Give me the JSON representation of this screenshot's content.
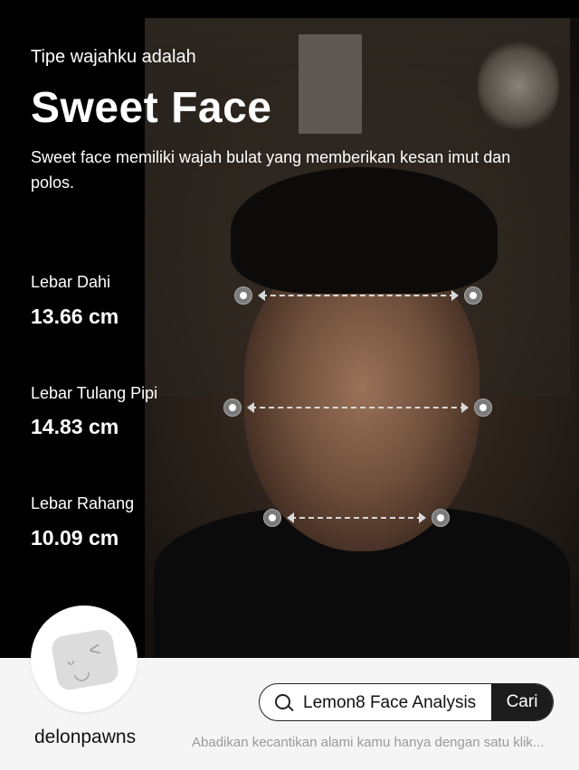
{
  "header": {
    "intro": "Tipe wajahku adalah",
    "title": "Sweet Face",
    "description": "Sweet face memiliki wajah bulat yang memberikan kesan imut dan polos."
  },
  "metrics": [
    {
      "label": "Lebar Dahi",
      "value": "13.66 cm"
    },
    {
      "label": "Lebar Tulang Pipi",
      "value": "14.83 cm"
    },
    {
      "label": "Lebar Rahang",
      "value": "10.09 cm"
    }
  ],
  "footer": {
    "username": "delonpawns",
    "search_query": "Lemon8 Face Analysis",
    "search_button": "Cari",
    "tagline": "Abadikan kecantikan alami kamu hanya dengan satu klik..."
  },
  "colors": {
    "overlay_text": "#ffffff",
    "footer_bg": "#f5f5f5",
    "button_bg": "#1c1c1c"
  },
  "icons": {
    "search": "search-icon",
    "avatar": "smiley-blob-icon"
  }
}
